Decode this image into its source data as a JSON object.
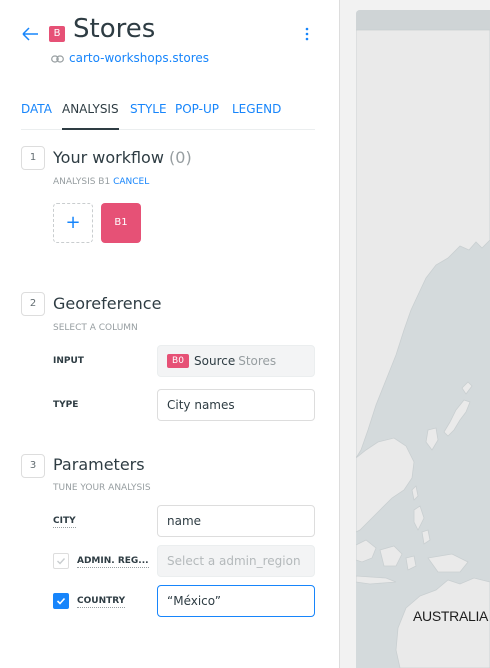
{
  "header": {
    "layer_letter": "B",
    "title": "Stores",
    "source": "carto-workshops.stores"
  },
  "tabs": [
    {
      "label": "DATA",
      "active": false
    },
    {
      "label": "ANALYSIS",
      "active": true
    },
    {
      "label": "STYLE",
      "active": false
    },
    {
      "label": "POP-UP",
      "active": false
    },
    {
      "label": "LEGEND",
      "active": false
    }
  ],
  "workflow": {
    "step": "1",
    "title": "Your workflow",
    "count": "(0)",
    "subtitle": "ANALYSIS B1",
    "cancel_label": "CANCEL",
    "add_label": "+",
    "node_label": "B1"
  },
  "georeference": {
    "step": "2",
    "title": "Georeference",
    "subtitle": "SELECT A COLUMN",
    "input_label": "INPUT",
    "input_badge": "B0",
    "input_source": "Source",
    "input_layer": "Stores",
    "type_label": "TYPE",
    "type_value": "City names"
  },
  "parameters": {
    "step": "3",
    "title": "Parameters",
    "subtitle": "TUNE YOUR ANALYSIS",
    "city_label": "CITY",
    "city_value": "name",
    "admin_label": "ADMIN. REG...",
    "admin_placeholder": "Select a admin_region",
    "admin_checked": false,
    "country_label": "COUNTRY",
    "country_value": "“México”",
    "country_checked": true
  },
  "map": {
    "label": "AUSTRALIA"
  },
  "colors": {
    "accent": "#1785fb",
    "layer": "#e65176"
  }
}
